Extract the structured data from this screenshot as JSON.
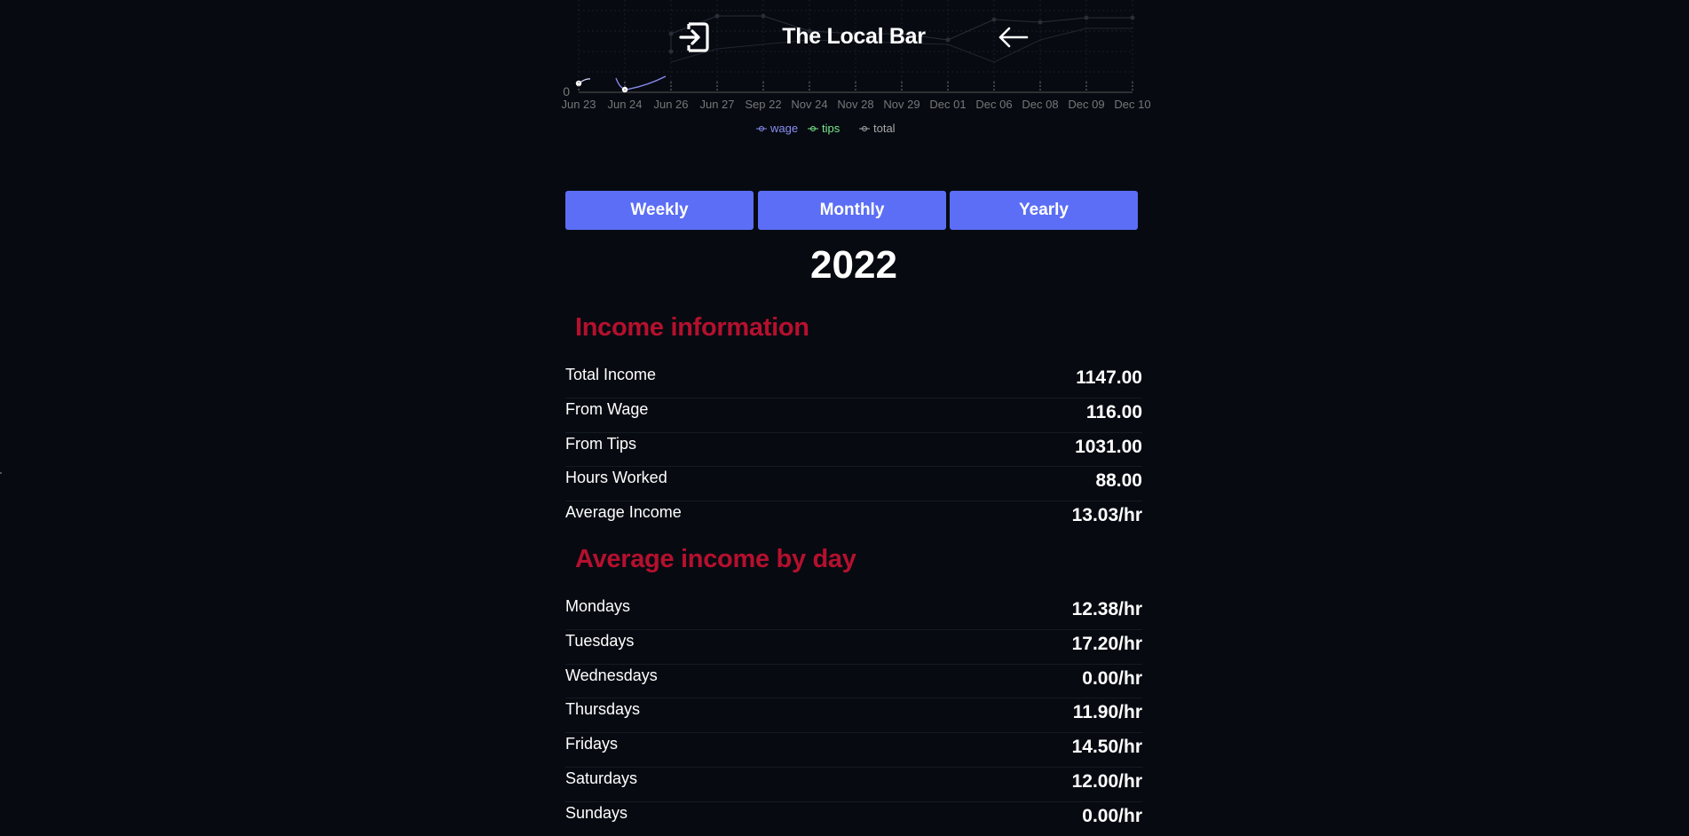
{
  "header": {
    "title": "The Local Bar",
    "logout_icon": "logout-icon",
    "back_icon": "arrow-left-icon"
  },
  "chart_data": {
    "type": "line",
    "categories": [
      "Jun 23",
      "Jun 24",
      "Jun 26",
      "Jun 27",
      "Sep 22",
      "Nov 24",
      "Nov 28",
      "Nov 29",
      "Dec 01",
      "Dec 06",
      "Dec 08",
      "Dec 09",
      "Dec 10"
    ],
    "series": [
      {
        "name": "wage",
        "color": "#8a8ef0"
      },
      {
        "name": "tips",
        "color": "#79e88a"
      },
      {
        "name": "total",
        "color": "#a8a8a8"
      }
    ],
    "ytick_visible": "0",
    "grid": true,
    "legend": "bottom-center"
  },
  "period_buttons": {
    "weekly": "Weekly",
    "monthly": "Monthly",
    "yearly": "Yearly"
  },
  "year": "2022",
  "income": {
    "heading": "Income information",
    "rows": [
      {
        "label": "Total Income",
        "value": "1147.00"
      },
      {
        "label": "From Wage",
        "value": "116.00"
      },
      {
        "label": "From Tips",
        "value": "1031.00"
      },
      {
        "label": "Hours Worked",
        "value": "88.00"
      },
      {
        "label": "Average Income",
        "value": "13.03/hr"
      }
    ]
  },
  "daily": {
    "heading": "Average income by day",
    "rows": [
      {
        "label": "Mondays",
        "value": "12.38/hr"
      },
      {
        "label": "Tuesdays",
        "value": "17.20/hr"
      },
      {
        "label": "Wednesdays",
        "value": "0.00/hr"
      },
      {
        "label": "Thursdays",
        "value": "11.90/hr"
      },
      {
        "label": "Fridays",
        "value": "14.50/hr"
      },
      {
        "label": "Saturdays",
        "value": "12.00/hr"
      },
      {
        "label": "Sundays",
        "value": "0.00/hr"
      }
    ]
  }
}
